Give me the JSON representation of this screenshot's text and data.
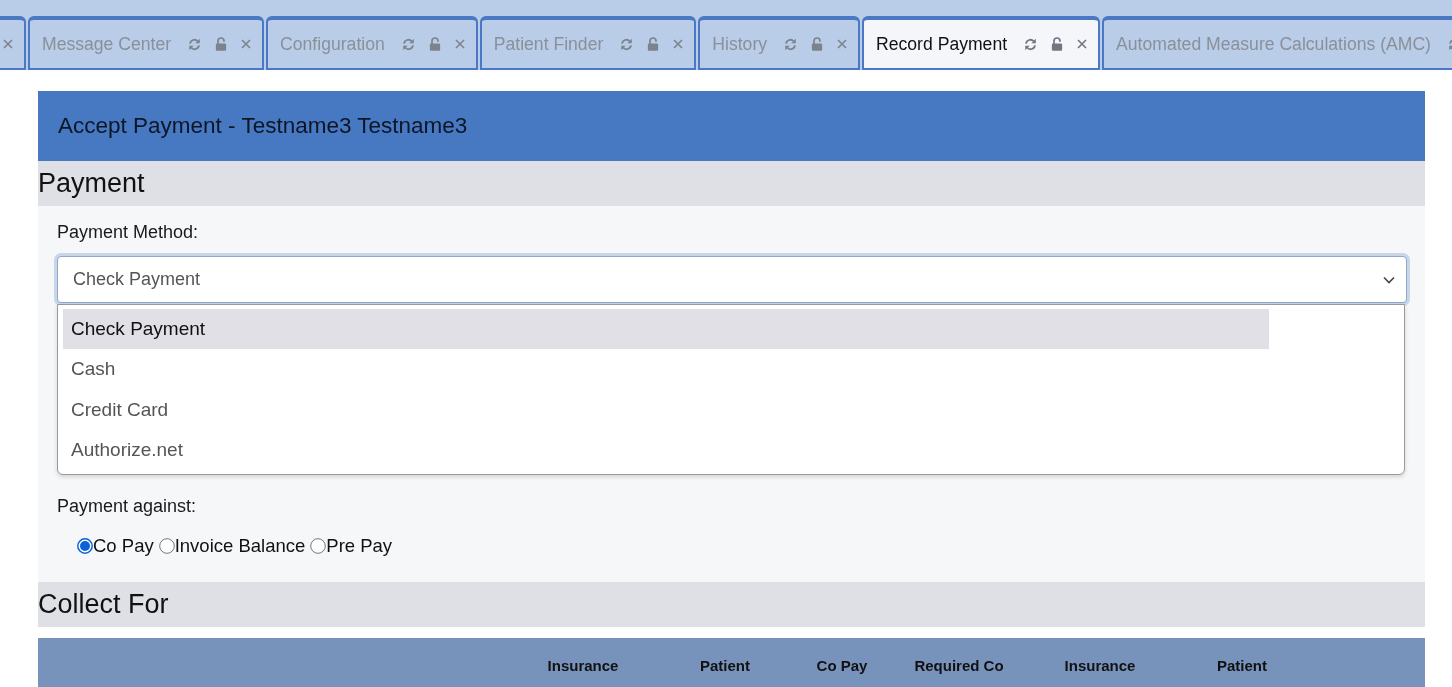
{
  "tabs": [
    {
      "selected": false
    },
    {
      "label": "Message Center",
      "selected": false
    },
    {
      "label": "Configuration",
      "selected": false
    },
    {
      "label": "Patient Finder",
      "selected": false
    },
    {
      "label": "History",
      "selected": false
    },
    {
      "label": "Record Payment",
      "selected": true
    },
    {
      "label": "Automated Measure Calculations (AMC)",
      "selected": false
    }
  ],
  "panel": {
    "title": "Accept Payment - Testname3 Testname3"
  },
  "payment_section": {
    "heading": "Payment",
    "method_label": "Payment Method:",
    "method_select": {
      "value": "Check Payment",
      "expanded": true,
      "options": [
        {
          "label": "Check Payment",
          "selected": true
        },
        {
          "label": "Cash",
          "selected": false
        },
        {
          "label": "Credit Card",
          "selected": false
        },
        {
          "label": "Authorize.net",
          "selected": false
        }
      ]
    },
    "against_label": "Payment against:",
    "against_options": [
      {
        "label": "Co Pay",
        "selected": true
      },
      {
        "label": "Invoice Balance",
        "selected": false
      },
      {
        "label": "Pre Pay",
        "selected": false
      }
    ]
  },
  "collect_section": {
    "heading": "Collect For",
    "table": {
      "columns": [
        "Insurance",
        "Patient",
        "Co Pay",
        "Required Co",
        "Insurance",
        "Patient"
      ]
    }
  }
}
